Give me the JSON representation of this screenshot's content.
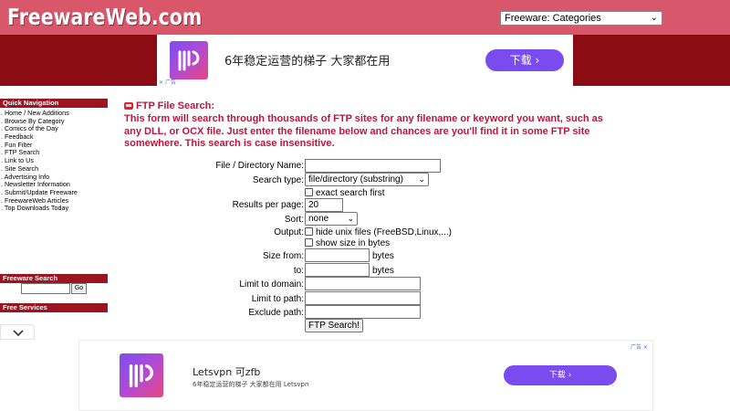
{
  "header": {
    "logo": "FreewareWeb.com",
    "category_select": "Freeware: Categories"
  },
  "top_ad": {
    "text": "6年稳定运营的梯子 大家都在用",
    "button": "下载",
    "ad_tag": "广告"
  },
  "sidebar": {
    "quick_nav_title": "Quick Navigation",
    "items": [
      ". Home / New Additions",
      ". Browse By Category",
      ". Comics of the Day",
      ". Feedback",
      ". Fun Filter",
      ". FTP Search",
      ". Link to Us",
      ". Site Search",
      ". Advertising Info",
      ". Newsletter Information",
      ". Submit/Update Freeware",
      ". FreewareWeb Articles",
      ". Top Downloads Today"
    ],
    "freeware_search_title": "Freeware Search",
    "go_button": "Go",
    "free_services_title": "Free Services"
  },
  "main": {
    "title": "FTP File Search:",
    "description": "This form will search through thousands of FTP sites for any filename or keyword you want, such as any DLL, or OCX file. Just enter the filename below and chances are you'll find it in some FTP site somewhere. This search is case insensitive.",
    "form": {
      "file_label": "File / Directory Name:",
      "search_type_label": "Search type:",
      "search_type_value": "file/directory (substring)",
      "exact_first_label": "exact search first",
      "results_label": "Results per page:",
      "results_value": "20",
      "sort_label": "Sort:",
      "sort_value": "none",
      "output_label": "Output:",
      "hide_unix_label": "hide unix files (FreeBSD,Linux,...)",
      "show_size_label": "show size in bytes",
      "size_from_label": "Size from:",
      "size_to_label": "to:",
      "bytes_unit": "bytes",
      "limit_domain_label": "Limit to domain:",
      "limit_path_label": "Limit to path:",
      "exclude_path_label": "Exclude path:",
      "submit_button": "FTP Search!"
    }
  },
  "bottom_ad": {
    "title": "Letsvpn 可zfb",
    "subtitle": "6年稳定运营的梯子 大家都在用 Letsvpn",
    "button": "下载",
    "ad_tag": "广告"
  },
  "colors": {
    "header_bg": "#d9576a",
    "dark_red": "#8b0c12",
    "heading_red": "#c0143c",
    "ad_purple": "#7a4cf0"
  }
}
